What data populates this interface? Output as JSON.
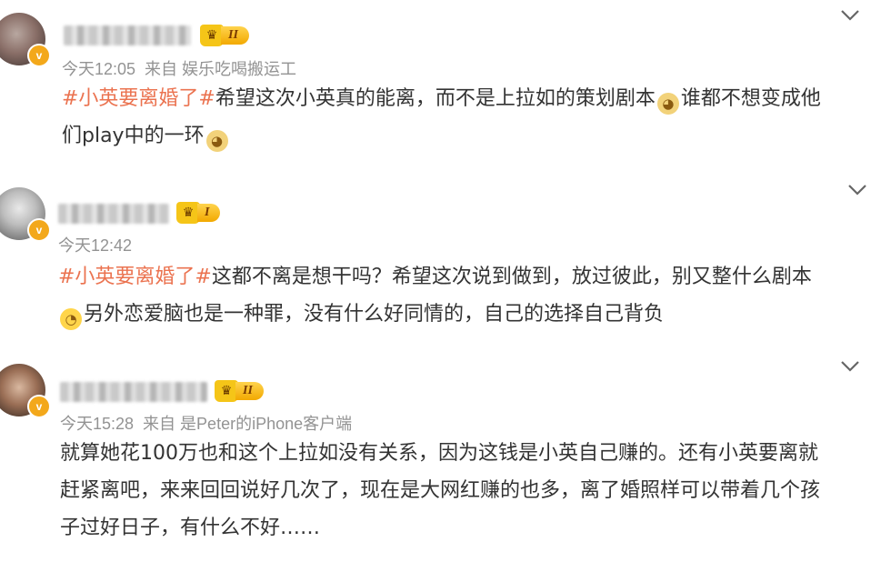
{
  "posts": [
    {
      "time": "今天12:05",
      "source": "来自 娱乐吃喝搬运工",
      "rank": "II",
      "topic": "#小英要离婚了#",
      "text_a": "希望这次小英真的能离，而不是上拉如的策划剧本",
      "text_b": "谁都不想变成他",
      "text_c": "们play中的一环",
      "emoji_1": "doge-icon",
      "emoji_2": "doge-icon"
    },
    {
      "time": "今天12:42",
      "rank": "I",
      "topic": "#小英要离婚了#",
      "text_a": "这都不离是想干吗？希望这次说到做到，放过彼此，别又整什么剧本",
      "text_b": "另外恋爱脑也是一种罪，没有什么好同情的，自己的选择自己背负",
      "emoji_1": "smirk-icon"
    },
    {
      "time": "今天15:28",
      "source": "来自 是Peter的iPhone客户端",
      "rank": "II",
      "line_1": "就算她花100万也和这个上拉如没有关系，因为这钱是小英自己赚的。还有小英要离就",
      "line_2": "赶紧离吧，来来回回说好几次了，现在是大网红赚的也多，离了婚照样可以带着几个孩",
      "line_3": "子过好日子，有什么不好……"
    }
  ],
  "colors": {
    "topic": "#eb7350",
    "meta": "#939393",
    "badge": "#f3a81b"
  }
}
